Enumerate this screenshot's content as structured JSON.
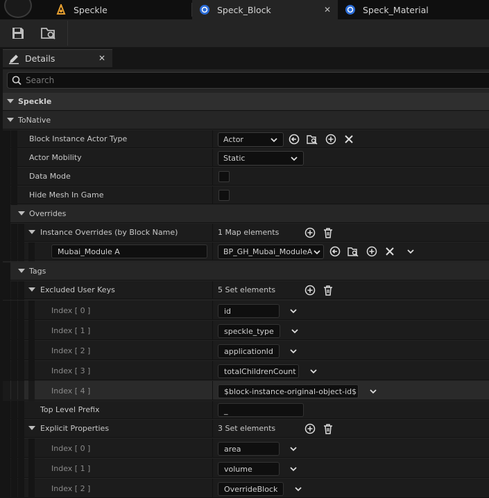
{
  "tabs": [
    {
      "label": "Speckle",
      "icon": "speckle-icon"
    },
    {
      "label": "Speck_Block",
      "icon": "blueprint-icon"
    },
    {
      "label": "Speck_Material",
      "icon": "blueprint-icon"
    }
  ],
  "details": {
    "tab_label": "Details",
    "search_placeholder": "Search"
  },
  "sections": {
    "speckle": "Speckle",
    "to_native": "ToNative",
    "overrides": "Overrides",
    "tags": "Tags"
  },
  "props": {
    "block_instance_actor_type": {
      "label": "Block Instance Actor Type",
      "value": "Actor"
    },
    "actor_mobility": {
      "label": "Actor Mobility",
      "value": "Static"
    },
    "data_mode": {
      "label": "Data Mode"
    },
    "hide_mesh_in_game": {
      "label": "Hide Mesh In Game"
    },
    "instance_overrides": {
      "label": "Instance Overrides (by Block Name)",
      "count": "1 Map elements",
      "key": "Mubai_Module A",
      "value": "BP_GH_Mubai_ModuleA"
    },
    "excluded_user_keys": {
      "label": "Excluded User Keys",
      "count": "5 Set elements",
      "items": [
        {
          "index": "Index [ 0 ]",
          "value": "id"
        },
        {
          "index": "Index [ 1 ]",
          "value": "speckle_type"
        },
        {
          "index": "Index [ 2 ]",
          "value": "applicationId"
        },
        {
          "index": "Index [ 3 ]",
          "value": "totalChildrenCount"
        },
        {
          "index": "Index [ 4 ]",
          "value": "$block-instance-original-object-id$"
        }
      ]
    },
    "top_level_prefix": {
      "label": "Top Level Prefix",
      "value": "_"
    },
    "explicit_properties": {
      "label": "Explicit Properties",
      "count": "3 Set elements",
      "items": [
        {
          "index": "Index [ 0 ]",
          "value": "area"
        },
        {
          "index": "Index [ 1 ]",
          "value": "volume"
        },
        {
          "index": "Index [ 2 ]",
          "value": "OverrideBlock"
        }
      ]
    }
  },
  "colors": {
    "panel": "#242424",
    "row": "#1c1c1c",
    "input": "#0f0f0f",
    "blueprint_icon": "#2b6cd6"
  }
}
